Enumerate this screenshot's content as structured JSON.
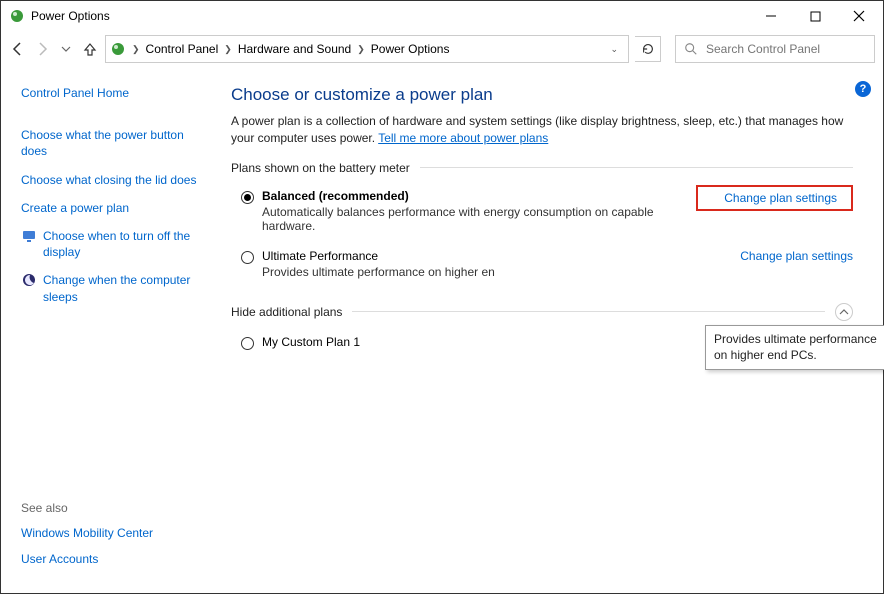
{
  "titlebar": {
    "title": "Power Options"
  },
  "breadcrumb": {
    "items": [
      "Control Panel",
      "Hardware and Sound",
      "Power Options"
    ]
  },
  "search": {
    "placeholder": "Search Control Panel"
  },
  "sidebar": {
    "home": "Control Panel Home",
    "links": [
      "Choose what the power button does",
      "Choose what closing the lid does",
      "Create a power plan",
      "Choose when to turn off the display",
      "Change when the computer sleeps"
    ],
    "see_also_header": "See also",
    "see_also": [
      "Windows Mobility Center",
      "User Accounts"
    ]
  },
  "main": {
    "heading": "Choose or customize a power plan",
    "desc_prefix": "A power plan is a collection of hardware and system settings (like display brightness, sleep, etc.) that manages how your computer uses power. ",
    "desc_link": "Tell me more about power plans",
    "plans_shown_label": "Plans shown on the battery meter",
    "hide_label": "Hide additional plans",
    "change_label": "Change plan settings",
    "plans_primary": [
      {
        "name": "Balanced (recommended)",
        "desc": "Automatically balances performance with energy consumption on capable hardware.",
        "selected": true
      },
      {
        "name": "Ultimate Performance",
        "desc": "Provides ultimate performance on higher en",
        "selected": false
      }
    ],
    "plans_additional": [
      {
        "name": "My Custom Plan 1",
        "desc": "",
        "selected": false
      }
    ],
    "tooltip": "Provides ultimate performance on higher end PCs."
  }
}
